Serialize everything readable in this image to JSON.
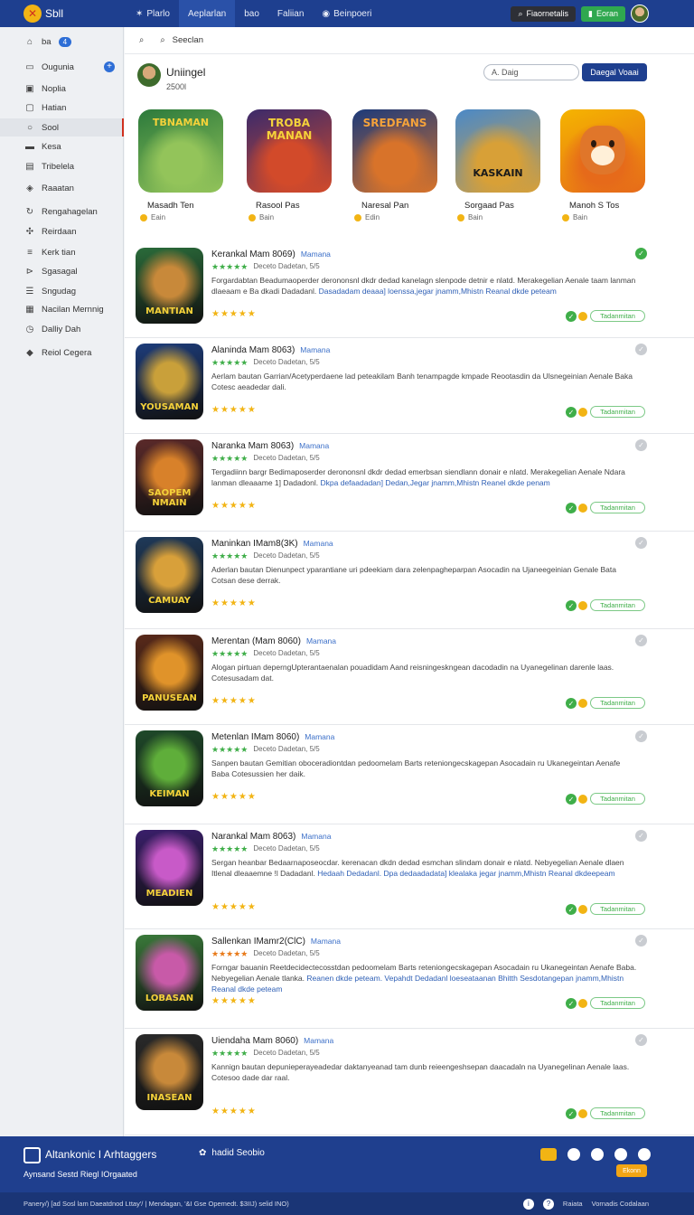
{
  "topbar": {
    "logo_text": "Sbll",
    "nav": [
      {
        "label": "Plarlo",
        "icon": "puzzle-icon"
      },
      {
        "label": "Aeplarlan",
        "icon": ""
      },
      {
        "label": "bao",
        "icon": ""
      },
      {
        "label": "Faliian",
        "icon": ""
      },
      {
        "label": "Beinpoeri",
        "icon": "globe-icon"
      }
    ],
    "search_label": "Fiaornetalis",
    "green_label": "Eoran"
  },
  "sidebar": {
    "top_label": "ba",
    "top_badge": "4",
    "items": [
      "Ougunia",
      "Noplia",
      "Hatian",
      "Sool",
      "Kesa",
      "Tribelela",
      "Raaatan",
      "Rengahagelan",
      "Reirdaan",
      "Kerk tian",
      "Sgasagal",
      "Sngudag",
      "Nacilan Mernnig",
      "Dalliy Dah",
      "Reiol Cegera"
    ]
  },
  "searchbar": {
    "label": "Seeclan"
  },
  "header": {
    "title": "Uniingel",
    "subtitle": "2500l",
    "filter_placeholder": "A. Daig",
    "button": "Daegal Voaai"
  },
  "featured": [
    {
      "name": "Masadh Ten",
      "price": "Eain",
      "art": "TBNAMAN",
      "colors": [
        "#2c7a3c",
        "#93c45a"
      ]
    },
    {
      "name": "Rasool Pas",
      "price": "Bain",
      "art": "TROBA MANAN",
      "colors": [
        "#3b2a6b",
        "#d24a2a"
      ]
    },
    {
      "name": "Naresal Pan",
      "price": "Edin",
      "art": "SREDFANS",
      "colors": [
        "#1c3a7a",
        "#d8732a"
      ]
    },
    {
      "name": "Sorgaad Pas",
      "price": "Bain",
      "art": "KASKAIN",
      "colors": [
        "#4a89c8",
        "#d8a037"
      ]
    },
    {
      "name": "Manoh S Tos",
      "price": "Bain",
      "art": "",
      "colors": [
        "#f5b400",
        "#e66a1a"
      ]
    }
  ],
  "list": [
    {
      "title": "Kerankal Mam 8069)",
      "tag": "Mamana",
      "stars_top": "★★★★★",
      "meta": "Deceto Dadetan, 5/5",
      "desc": "Forgardabtan Beadumaoperder derononsnl dkdr dedad kanelagn slenpode detnir e nlatd. Merakegelian Aenale taam lanman dlaeaam e Ba dkadi Dadadanl.",
      "desc_link": "Dasadadam deaaa] loenssa,jegar jnamm,Mhistn Reanal dkde peteam",
      "art": "MANTIAN",
      "colors": [
        "#2a6b3a",
        "#c8893a"
      ],
      "dot": "ok"
    },
    {
      "title": "Alaninda Mam 8063)",
      "tag": "Mamana",
      "stars_top": "★★★★★",
      "meta": "Deceto Dadetan, 5/5",
      "desc": "Aerlam bautan Garrian/Acetyperdaene lad peteakilam Banh tenampagde kmpade Reootasdin da Ulsnegeinian Aenale Baka Cotesc aeadedar dali.",
      "desc_link": "",
      "art": "YOUSAMAN",
      "colors": [
        "#1d3c7a",
        "#c9a03a"
      ],
      "dot": "off"
    },
    {
      "title": "Naranka Mam 8063)",
      "tag": "Mamana",
      "stars_top": "★★★★★",
      "meta": "Deceto Dadetan, 5/5",
      "desc": "Tergadiinn bargr Bedimaposerder derononsnl dkdr dedad emerbsan siendlann donair e nlatd. Merakegelian Aenale Ndara lanman dleaaame 1] Dadadonl.",
      "desc_link": "Dkpa defaadadan] Dedan,Jegar jnamm,Mhistn Reanel dkde penam",
      "art": "SAOPEM NMAIN",
      "colors": [
        "#5b2a2a",
        "#d8812a"
      ],
      "dot": "off"
    },
    {
      "title": "Maninkan IMam8(3K)",
      "tag": "Mamana",
      "stars_top": "★★★★★",
      "meta": "Deceto Dadetan, 5/5",
      "desc": "Aderlan bautan Dienunpect yparantiane uri pdeekiam dara zelenpagheparpan Asocadin na Ujaneegeinian Genale Bata Cotsan dese derrak.",
      "desc_link": "",
      "art": "CAMUAY",
      "colors": [
        "#1f3a5a",
        "#d8a03a"
      ],
      "dot": "off"
    },
    {
      "title": "Merentan (Mam 8060)",
      "tag": "Mamana",
      "stars_top": "★★★★★",
      "meta": "Deceto Dadetan, 5/5",
      "desc": "Alogan pirtuan deperngUpterantaenalan pouadidam Aand reisningeskngean dacodadin na Uyanegelinan darenle laas. Cotesusadam dat.",
      "desc_link": "",
      "art": "PANUSEAN",
      "colors": [
        "#5a2a1a",
        "#e0932a"
      ],
      "dot": "off"
    },
    {
      "title": "Metenlan IMam 8060)",
      "tag": "Mamana",
      "stars_top": "★★★★★",
      "meta": "Deceto Dadetan, 5/5",
      "desc": "Sanpen bautan Gemitian oboceradiontdan pedoomelam Barts reteniongecskagepan Asocadain ru Ukanegeintan Aenafe Baba Cotesussien her daik.",
      "desc_link": "",
      "art": "KEIMAN",
      "colors": [
        "#1f4a2a",
        "#5fae3a"
      ],
      "dot": "off"
    },
    {
      "title": "Narankal Mam 8063)",
      "tag": "Mamana",
      "stars_top": "★★★★★",
      "meta": "Deceto Dadetan, 5/5",
      "desc": "Sergan heanbar Bedaarnaposeocdar. kerenacan dkdn dedad esmchan slindam donair e nlatd. Nebyegelian Aenale dlaen Itlenal dleaaemne !l Dadadanl.",
      "desc_link": "Hedaah Dedadanl. Dpa dedaadadata] klealaka jegar jnamm,Mhistn Reanal dkdeepeam",
      "art": "MEADIEN",
      "colors": [
        "#3a1f6b",
        "#c85ac8"
      ],
      "dot": "off"
    },
    {
      "title": "Sallenkan IMamr2(ClC)",
      "tag": "Mamana",
      "stars_top": "★★★★★",
      "meta": "Deceto Dadetan, 5/5",
      "desc": "Forngar bauanin Reetdecidectecosstdan pedoomelam Barts reteniongecskagepan Asocadain ru Ukanegeintan Aenafe Baba. Nebyegelian Aenale tlanka.",
      "desc_link": "Reanen dkde peteam. Vepahdt Dedadanl loeseataanan Bhitth Sesdotangepan jnamm,Mhistn Reanal dkde peteam",
      "art": "LOBASAN",
      "colors": [
        "#3a7a3a",
        "#c85aa8"
      ],
      "dot": "off"
    },
    {
      "title": "Uiendaha Mam 8060)",
      "tag": "Mamana",
      "stars_top": "★★★★★",
      "meta": "Deceto Dadetan, 5/5",
      "desc": "Kannign bautan depunieperayeadedar daktanyeanad tam dunb reieengeshsepan daacadaln na Uyanegelinan Aenale laas. Cotesoo dade dar raal.",
      "desc_link": "",
      "art": "INASEAN",
      "colors": [
        "#2a2a2a",
        "#c8893a"
      ],
      "dot": "off"
    }
  ],
  "row_button": "Tadanmitan",
  "footer": {
    "title": "Altankonic I Arhtaggers",
    "mid_label": "hadid Seobio",
    "sub": "Aynsand Sestd Riegl IOrgaated",
    "orange": "Ekonn",
    "bottom_text": "Panery/) [ad Sosl lam Daeatdnod Lttay'/ | Mendagan, '&I Gse Opemedt. $3IIJ) selid INO)",
    "bottom_right_1": "Raiata",
    "bottom_right_2": "Vornadis Codalaan"
  }
}
